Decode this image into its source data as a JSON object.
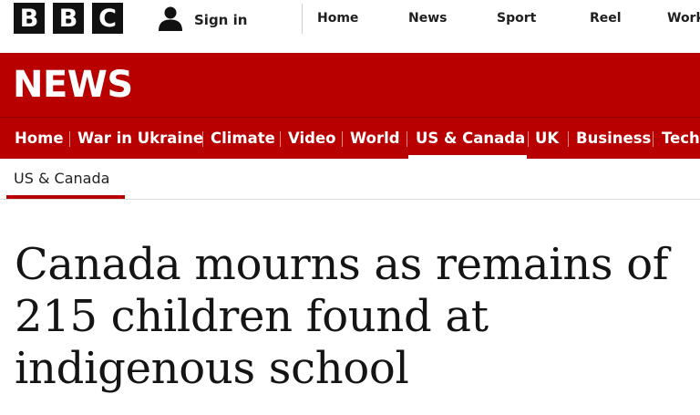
{
  "brand": {
    "letters": [
      "B",
      "B",
      "C"
    ]
  },
  "account": {
    "signin_label": "Sign in",
    "icon": "user-icon"
  },
  "top_nav": [
    {
      "label": "Home"
    },
    {
      "label": "News"
    },
    {
      "label": "Sport"
    },
    {
      "label": "Reel"
    },
    {
      "label": "Work"
    }
  ],
  "banner": {
    "title": "NEWS",
    "color": "#b80000"
  },
  "section_nav": [
    {
      "label": "Home"
    },
    {
      "label": "War in Ukraine"
    },
    {
      "label": "Climate"
    },
    {
      "label": "Video"
    },
    {
      "label": "World"
    },
    {
      "label": "US & Canada",
      "active": true
    },
    {
      "label": "UK"
    },
    {
      "label": "Business"
    },
    {
      "label": "Tech"
    }
  ],
  "breadcrumb": {
    "section": "US & Canada"
  },
  "article": {
    "headline": "Canada mourns as remains of 215 children found at indigenous school"
  }
}
